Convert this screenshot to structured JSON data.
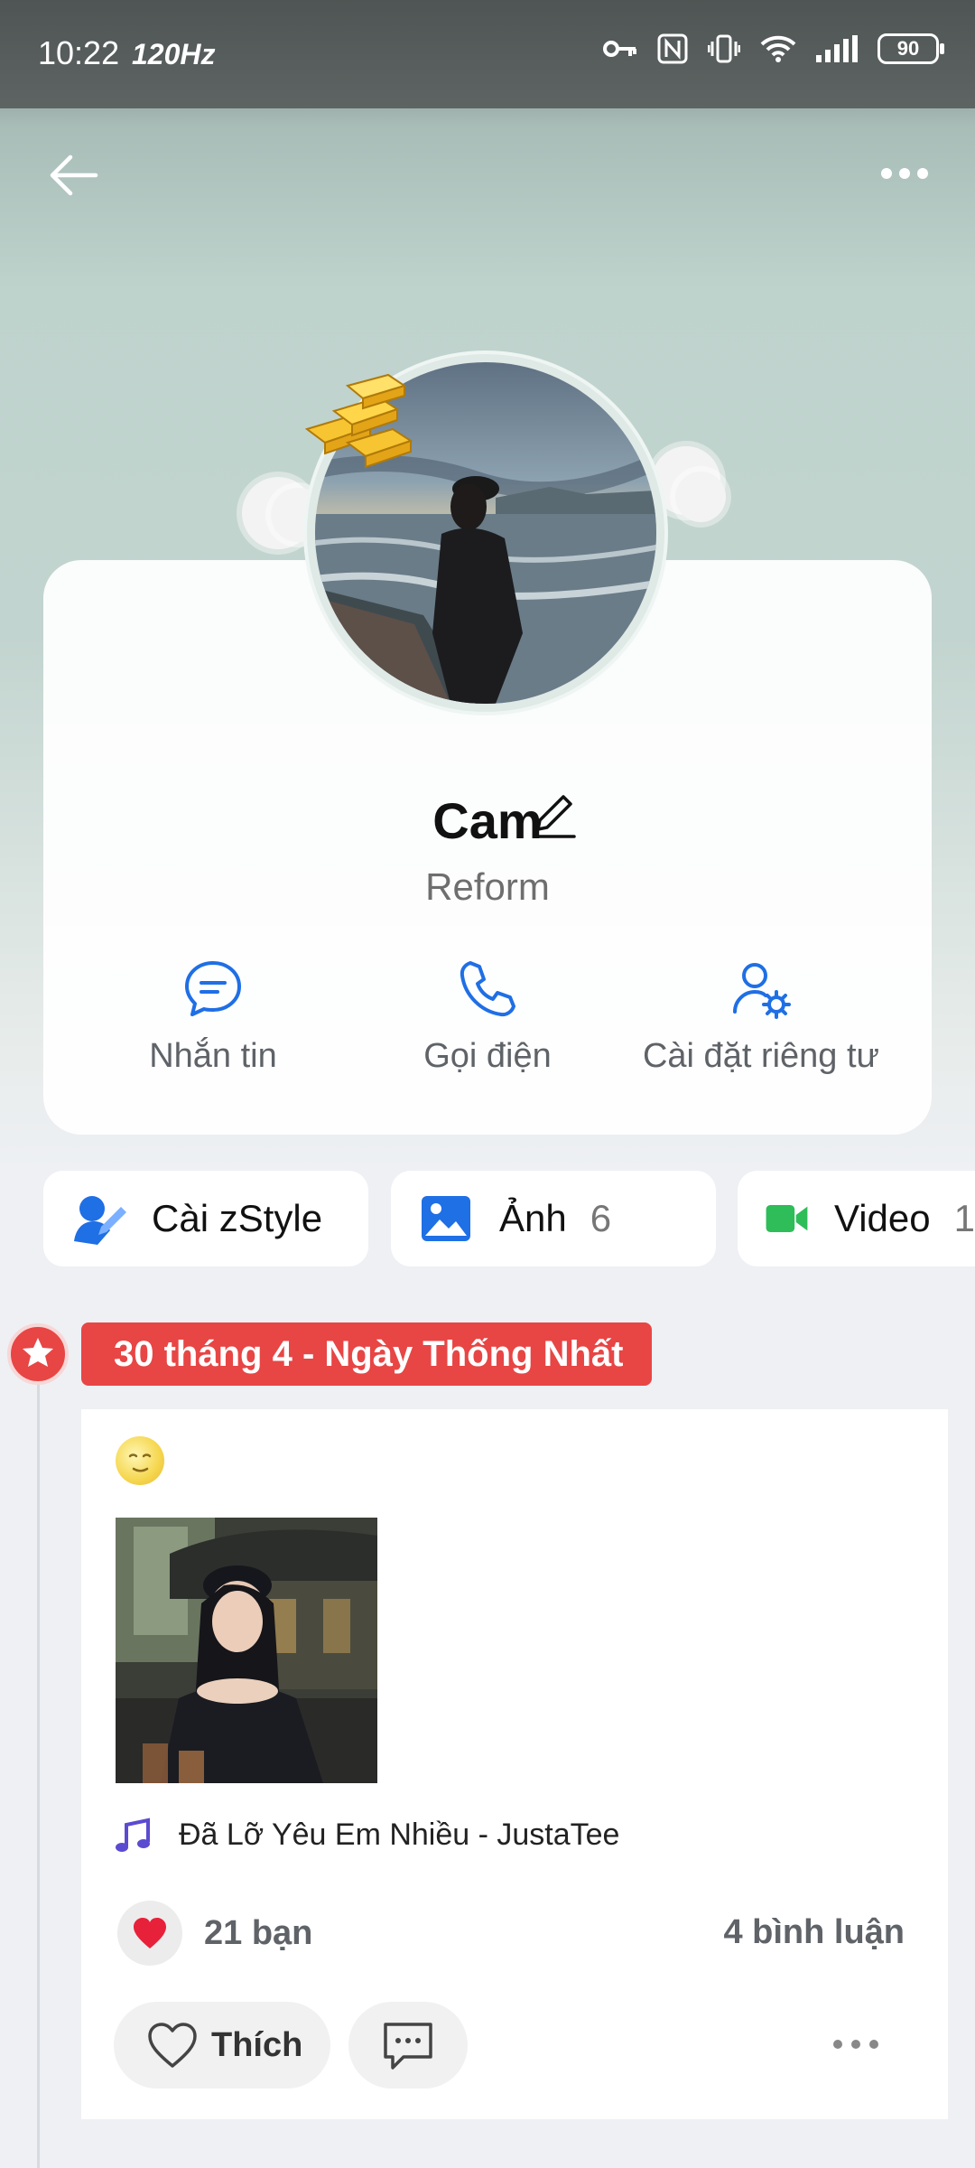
{
  "status_bar": {
    "time": "10:22",
    "refresh_rate": "120Hz",
    "battery": "90"
  },
  "profile": {
    "name": "Cam",
    "subtitle": "Reform"
  },
  "actions": [
    {
      "label": "Nhắn tin",
      "icon": "chat-icon"
    },
    {
      "label": "Gọi điện",
      "icon": "phone-icon"
    },
    {
      "label": "Cài đặt riêng tư",
      "icon": "user-settings-icon"
    }
  ],
  "chips": [
    {
      "label": "Cài zStyle",
      "icon": "zstyle-icon"
    },
    {
      "label": "Ảnh",
      "count": "6",
      "icon": "image-icon"
    },
    {
      "label": "Video",
      "count": "1",
      "icon": "video-icon"
    }
  ],
  "timeline": {
    "banner": "30 tháng 4 - Ngày Thống Nhất",
    "post": {
      "music": "Đã Lỡ Yêu Em Nhiều - JustaTee",
      "likes": "21 bạn",
      "comments": "4 bình luận",
      "like_label": "Thích"
    }
  },
  "colors": {
    "accent_blue": "#1f6fe5",
    "banner_red": "#e84545",
    "chip_green": "#2ebd59"
  }
}
